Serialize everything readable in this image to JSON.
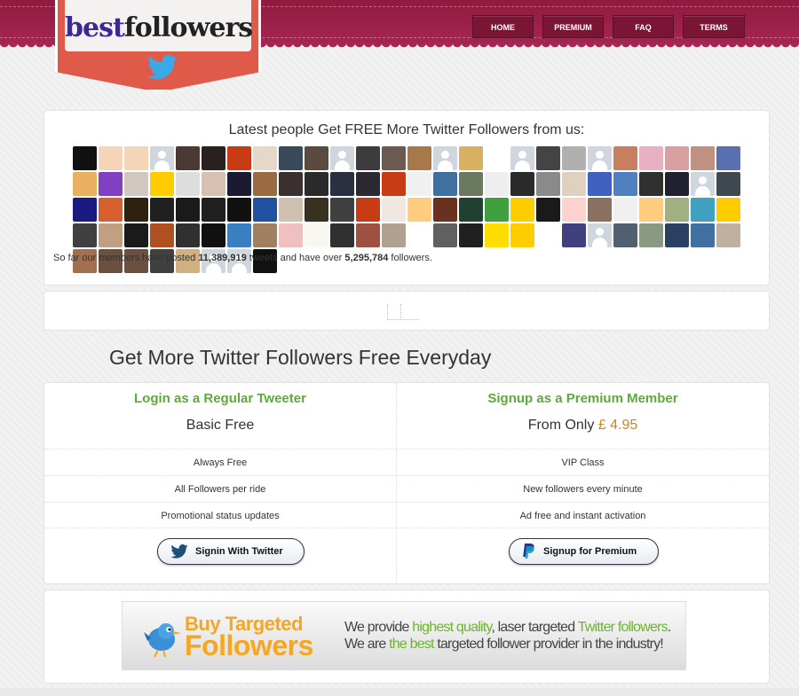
{
  "logo": {
    "part1": "best",
    "part2": "followers"
  },
  "nav": [
    {
      "label": "HOME"
    },
    {
      "label": "PREMIUM"
    },
    {
      "label": "FAQ"
    },
    {
      "label": "TERMS"
    }
  ],
  "latest": {
    "heading": "Latest people Get FREE More Twitter Followers from us:",
    "avatar_colors": [
      "#111",
      "#f5d5b8",
      "#f5d5b8",
      "default",
      "#4a3a33",
      "#2b2020",
      "#c73c14",
      "#e6d8c8",
      "#3a4a5a",
      "#5a4a40",
      "default",
      "#3c3c3c",
      "#6a5a50",
      "#a8784a",
      "default",
      "#d9b060",
      "#fff",
      "default",
      "#444",
      "#b0b0b0",
      "default",
      "#c68060",
      "#e8b0c0",
      "#d8a0a0",
      "#c09080",
      "#5a70b0",
      "#e8b060",
      "#8040c0",
      "#d0c8c0",
      "#ffcc00",
      "#ddd",
      "#d8c0b0",
      "#1a1a30",
      "#9a6a40",
      "#3a3030",
      "#2a2a2a",
      "#2a3040",
      "#2a2a30",
      "#c73c14",
      "#f0f0f0",
      "#4070a0",
      "#6a7a60",
      "#eee",
      "#2a2a2a",
      "#8a8a8a",
      "#e0d0c0",
      "#4060c0",
      "#5080c0",
      "#303030",
      "#202030",
      "default",
      "#404850",
      "#1a1a80",
      "#d86030",
      "#302010",
      "#202020",
      "#1a1a1a",
      "#202020",
      "#101010",
      "#2050a0",
      "#d0c0b0",
      "#3a3020",
      "#404040",
      "#c73c14",
      "#f0e8e0",
      "#ffcc80",
      "#6a3020",
      "#204030",
      "#40a040",
      "#ffcc00",
      "#1a1a1a",
      "#ffd0d0",
      "#8a7060",
      "#f0f0f0",
      "#ffcc80",
      "#a0b080",
      "#40a0c0",
      "#ffcc00",
      "#404040",
      "#c0a080",
      "#1a1a1a",
      "#b05020",
      "#303030",
      "#101010",
      "#3a80c0",
      "#a08060",
      "#f0c0c0",
      "#f8f8f0",
      "#303030",
      "#a05040",
      "#b0a090",
      "#fff",
      "#606060",
      "#202020",
      "#ffdd00",
      "#ffcc00",
      "#fff",
      "#404080",
      "default",
      "#506070",
      "#8a9a80",
      "#2a4060",
      "#4070a0",
      "#c0b0a0",
      "#a07050",
      "#6a5040",
      "#6a5040",
      "#404040",
      "#d0b080",
      "default",
      "default",
      "#111"
    ]
  },
  "stats": {
    "prefix": "So far our members have posted",
    "tweets": "11,389,919",
    "middle": "tweets and have over",
    "followers": "5,295,784",
    "suffix": "followers."
  },
  "headline": "Get More Twitter Followers Free Everyday",
  "plans": {
    "regular": {
      "title": "Login as a Regular Tweeter",
      "price": "Basic Free",
      "features": [
        "Always Free",
        "All Followers per ride",
        "Promotional status updates"
      ],
      "button": "Signin With Twitter"
    },
    "premium": {
      "title": "Signup as a Premium Member",
      "price_prefix": "From Only",
      "price_amount": "£ 4.95",
      "features": [
        "VIP Class",
        "New followers every minute",
        "Ad free and instant activation"
      ],
      "button": "Signup for Premium"
    }
  },
  "promo": {
    "title_line1": "Buy Targeted",
    "title_line2": "Followers",
    "line1_a": "We provide ",
    "line1_b": "highest quality",
    "line1_c": ", laser targeted ",
    "line1_d": "Twitter followers",
    "line1_e": ".",
    "line2_a": "We are ",
    "line2_b": "the best",
    "line2_c": " targeted follower provider in the industry!"
  },
  "colors": {
    "header": "#a62552",
    "accent_green": "#5cab3a",
    "price_gold": "#c08a1e",
    "logo_red": "#e05a4a"
  }
}
